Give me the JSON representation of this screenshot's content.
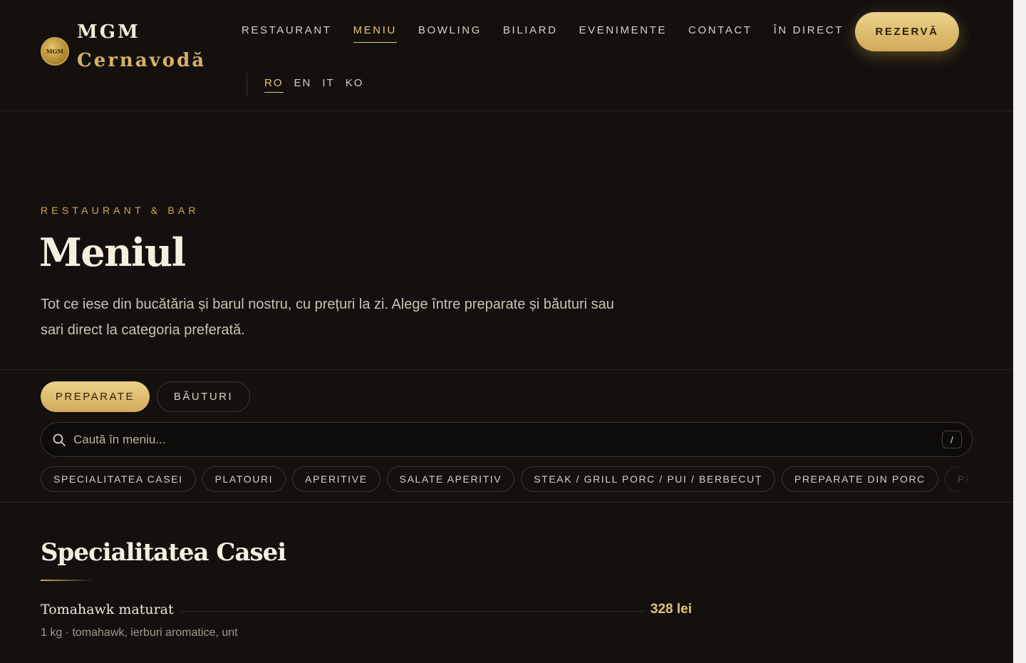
{
  "brand": {
    "badge_text": "MGM",
    "line1": "MGM",
    "line2": "Cernavodă"
  },
  "nav": {
    "items": [
      {
        "label": "RESTAURANT",
        "active": false
      },
      {
        "label": "MENIU",
        "active": true
      },
      {
        "label": "BOWLING",
        "active": false
      },
      {
        "label": "BILIARD",
        "active": false
      },
      {
        "label": "EVENIMENTE",
        "active": false
      },
      {
        "label": "CONTACT",
        "active": false
      },
      {
        "label": "ÎN DIRECT",
        "active": false
      }
    ],
    "reserve_label": "REZERVĂ"
  },
  "languages": [
    {
      "label": "RO",
      "active": true
    },
    {
      "label": "EN",
      "active": false
    },
    {
      "label": "IT",
      "active": false
    },
    {
      "label": "KO",
      "active": false
    }
  ],
  "hero": {
    "eyebrow": "RESTAURANT & BAR",
    "title": "Meniul",
    "description": "Tot ce iese din bucătăria și barul nostru, cu prețuri la zi. Alege între preparate și băuturi sau sari direct la categoria preferată."
  },
  "tabs": {
    "food": "PREPARATE",
    "drinks": "BĂUTURI"
  },
  "search": {
    "placeholder": "Caută în meniu...",
    "shortcut": "/"
  },
  "categories": [
    "SPECIALITATEA CASEI",
    "PLATOURI",
    "APERITIVE",
    "SALATE APERITIV",
    "STEAK / GRILL PORC / PUI / BERBECUȚ",
    "PREPARATE DIN PORC",
    "PREPARATE DIN"
  ],
  "section": {
    "title": "Specialitatea Casei",
    "items": [
      {
        "name": "Tomahawk maturat",
        "price": "328 lei",
        "description": "1 kg · tomahawk, ierburi aromatice, unt"
      }
    ]
  },
  "colors": {
    "background": "#13100d",
    "accent": "#d2ab59",
    "accent_text": "#e3c47c"
  }
}
